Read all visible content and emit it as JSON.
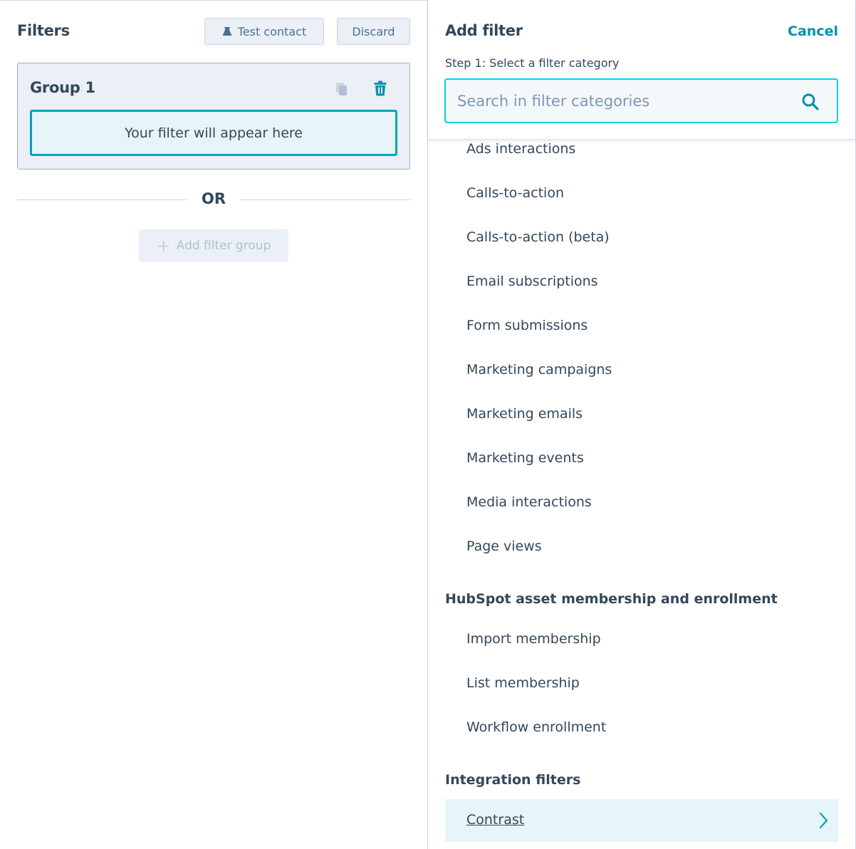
{
  "left_panel": {
    "title": "Filters",
    "test_contact_label": "Test contact",
    "discard_label": "Discard",
    "group": {
      "title": "Group 1",
      "placeholder_text": "Your filter will appear here"
    },
    "or_label": "OR",
    "add_filter_group_label": "Add filter group"
  },
  "right_panel": {
    "title": "Add filter",
    "cancel_label": "Cancel",
    "step_label": "Step 1: Select a filter category",
    "search": {
      "placeholder": "Search in filter categories",
      "value": ""
    },
    "items_top": [
      "Ads interactions",
      "Calls-to-action",
      "Calls-to-action (beta)",
      "Email subscriptions",
      "Form submissions",
      "Marketing campaigns",
      "Marketing emails",
      "Marketing events",
      "Media interactions",
      "Page views"
    ],
    "section_hubspot": {
      "title": "HubSpot asset membership and enrollment",
      "items": [
        "Import membership",
        "List membership",
        "Workflow enrollment"
      ]
    },
    "section_integration": {
      "title": "Integration filters",
      "items": [
        "Contrast"
      ]
    }
  },
  "colors": {
    "accent": "#00a4bd",
    "link": "#0091ae",
    "text": "#33475b",
    "highlight_bg": "#e5f5f8"
  }
}
